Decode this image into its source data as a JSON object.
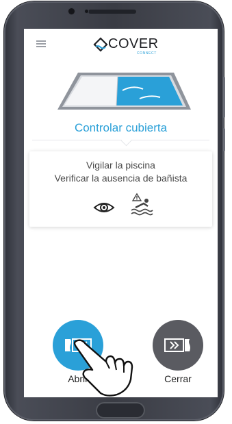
{
  "app": {
    "logo_text": "COVER",
    "logo_subtext": "CONNECT"
  },
  "icons": {
    "menu": "hamburger-menu-icon",
    "logo": "cover-logo-icon",
    "eye": "eye-icon",
    "swimmer": "swimmer-warning-icon",
    "open": "open-cover-icon",
    "close": "close-cover-icon",
    "hand": "tap-hand-icon"
  },
  "main": {
    "title": "Controlar cubierta",
    "card": {
      "line1": "Vigilar la piscina",
      "line2": "Verificar la ausencia de bañista"
    },
    "open_label": "Abrir",
    "close_label": "Cerrar"
  },
  "colors": {
    "accent": "#2aa0d8",
    "dark_button": "#5a5b61"
  }
}
